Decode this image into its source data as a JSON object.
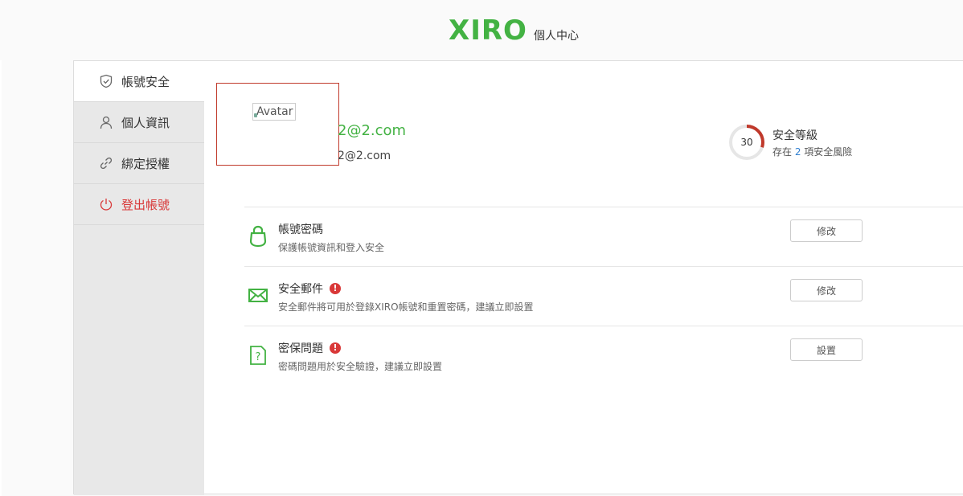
{
  "header": {
    "logo": "XIRO",
    "subtitle": "個人中心",
    "brand_color": "#43b243"
  },
  "sidebar": {
    "items": [
      {
        "label": "帳號安全",
        "icon": "shield-icon",
        "active": true
      },
      {
        "label": "個人資訊",
        "icon": "user-icon",
        "active": false
      },
      {
        "label": "綁定授權",
        "icon": "link-icon",
        "active": false
      },
      {
        "label": "登出帳號",
        "icon": "power-icon",
        "active": false
      }
    ]
  },
  "profile": {
    "avatar_alt": "Avatar",
    "email_main": "2@2.com",
    "email_sub": "2@2.com"
  },
  "security_level": {
    "score": "30",
    "score_fraction": 0.3,
    "title": "安全等級",
    "desc_prefix": "存在 ",
    "risk_count": "2",
    "desc_suffix": " 項安全風險",
    "ring_color": "#c0392b"
  },
  "settings": [
    {
      "title": "帳號密碼",
      "desc": "保護帳號資訊和登入安全",
      "button": "修改",
      "warning": false,
      "icon": "lock-icon"
    },
    {
      "title": "安全郵件",
      "desc": "安全郵件將可用於登錄XIRO帳號和重置密碼，建議立即設置",
      "button": "修改",
      "warning": true,
      "icon": "mail-icon"
    },
    {
      "title": "密保問題",
      "desc": "密碼問題用於安全驗證，建議立即設置",
      "button": "設置",
      "warning": true,
      "icon": "question-doc-icon"
    }
  ],
  "warning_glyph": "!"
}
